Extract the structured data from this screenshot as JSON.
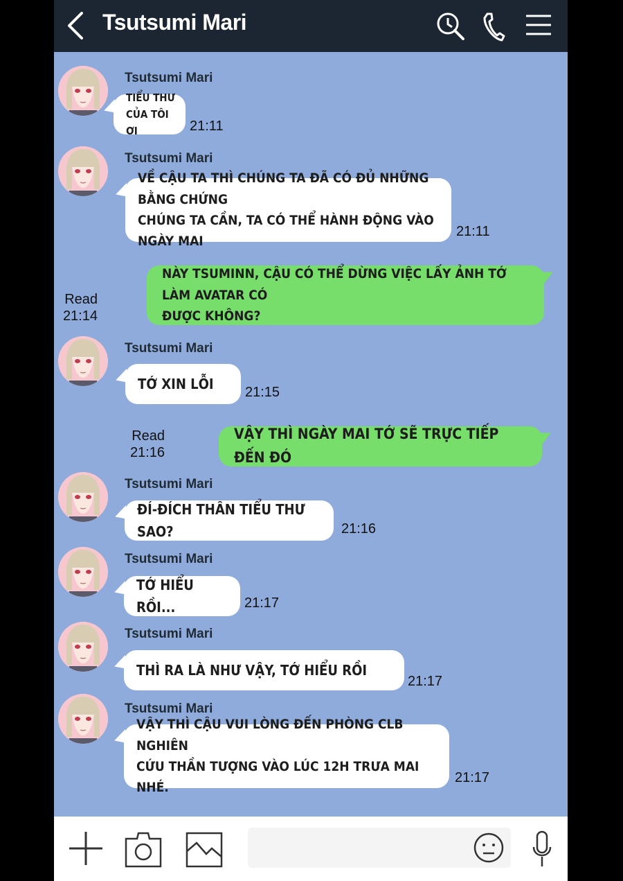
{
  "header": {
    "title": "Tsutsumi Mari",
    "back_icon": "chevron-left-icon",
    "icons": [
      "search-icon",
      "phone-icon",
      "menu-icon"
    ]
  },
  "colors": {
    "header_bg": "#1b2632",
    "chat_bg": "#8eabdb",
    "incoming_bubble": "#ffffff",
    "outgoing_bubble": "#77de6c"
  },
  "messages": [
    {
      "dir": "in",
      "sender": "Tsutsumi Mari",
      "lines": [
        "TIỂU THƯ",
        "CỦA TÔI ƠI"
      ],
      "time": "21:11"
    },
    {
      "dir": "in",
      "sender": "Tsutsumi Mari",
      "lines": [
        "VỀ CẬU TA THÌ CHÚNG TA ĐÃ CÓ ĐỦ NHỮNG BẰNG CHỨNG",
        "CHÚNG TA CẦN, TA CÓ THỂ HÀNH ĐỘNG VÀO NGÀY MAI"
      ],
      "time": "21:11"
    },
    {
      "dir": "out",
      "read": "Read",
      "lines": [
        "NÀY TSUMINN, CẬU CÓ THỂ DỪNG VIỆC LẤY ẢNH TỚ LÀM AVATAR CÓ",
        "ĐƯỢC KHÔNG?"
      ],
      "time": "21:14"
    },
    {
      "dir": "in",
      "sender": "Tsutsumi Mari",
      "lines": [
        "TỚ XIN LỖI"
      ],
      "time": "21:15"
    },
    {
      "dir": "out",
      "read": "Read",
      "lines": [
        "VẬY THÌ NGÀY MAI TỚ SẼ TRỰC TIẾP ĐẾN ĐÓ"
      ],
      "time": "21:16"
    },
    {
      "dir": "in",
      "sender": "Tsutsumi Mari",
      "lines": [
        "ĐÍ-ĐÍCH THÂN TIỂU THƯ SAO?"
      ],
      "time": "21:16"
    },
    {
      "dir": "in",
      "sender": "Tsutsumi Mari",
      "lines": [
        "TỚ HIỂU RỒI..."
      ],
      "time": "21:17"
    },
    {
      "dir": "in",
      "sender": "Tsutsumi Mari",
      "lines": [
        "THÌ RA LÀ NHƯ VẬY, TỚ HIỂU RỒI"
      ],
      "time": "21:17"
    },
    {
      "dir": "in",
      "sender": "Tsutsumi Mari",
      "lines": [
        "VẬY THÌ CẬU VUI LÒNG ĐẾN PHÒNG CLB NGHIÊN",
        "CỨU THẦN TƯỢNG VÀO LÚC 12H TRƯA MAI NHÉ."
      ],
      "time": "21:17"
    }
  ],
  "input": {
    "value": "",
    "placeholder": ""
  },
  "bottom_icons": [
    "plus-icon",
    "camera-icon",
    "image-icon",
    "emoji-icon",
    "microphone-icon"
  ]
}
